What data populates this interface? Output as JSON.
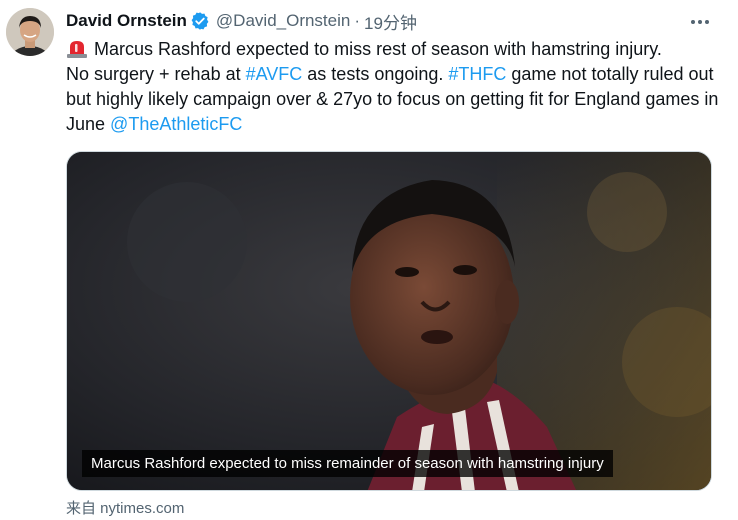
{
  "author": {
    "name": "David Ornstein",
    "handle": "@David_Ornstein",
    "separator": "·",
    "time": "19分钟",
    "verified_icon": "verified-badge-icon"
  },
  "tweet": {
    "line1": "Marcus Rashford expected to miss rest of season with hamstring injury.",
    "seg_a": "No surgery + rehab at ",
    "tag_avfc": "#AVFC",
    "seg_b": " as tests ongoing. ",
    "tag_thfc": "#THFC",
    "seg_c": " game not totally ruled out but highly likely campaign over & 27yo to focus on getting fit for England games in June ",
    "mention": "@TheAthleticFC"
  },
  "media": {
    "caption": "Marcus Rashford expected to miss remainder of season with hamstring injury"
  },
  "source": {
    "label": "来自 nytimes.com"
  },
  "colors": {
    "link": "#1d9bf0",
    "verified": "#1d9bf0",
    "secondary_text": "#536471"
  }
}
